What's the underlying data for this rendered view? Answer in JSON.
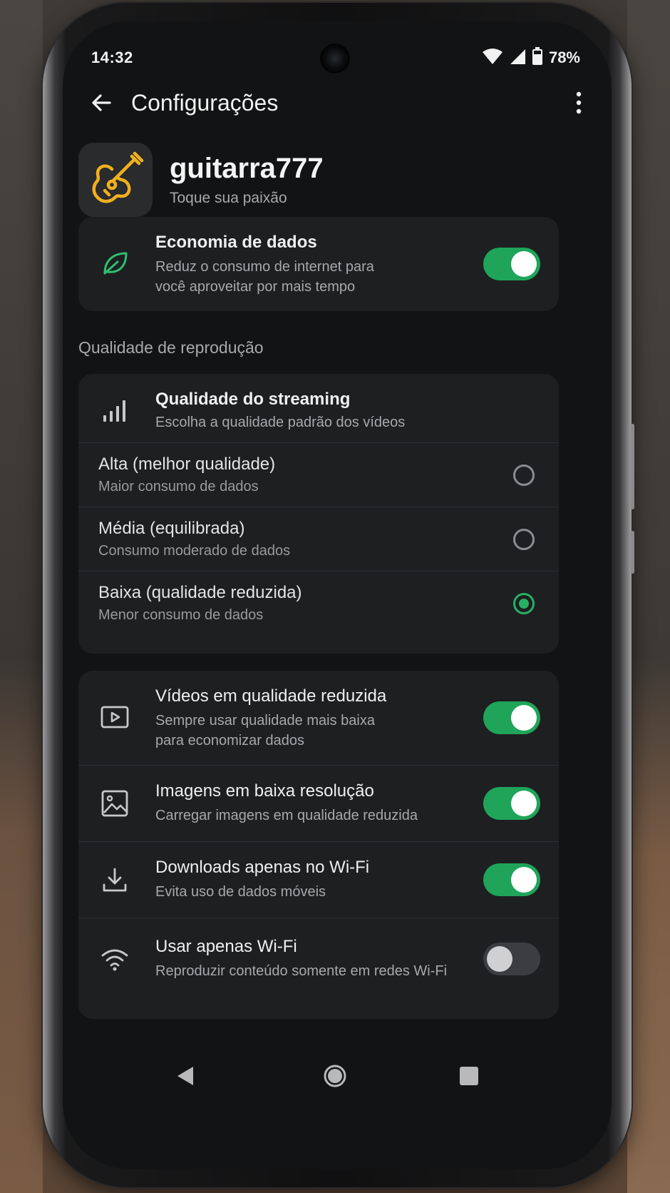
{
  "status_bar": {
    "time": "14:32",
    "battery": "78%",
    "icons": [
      "wifi-icon",
      "signal-icon",
      "battery-icon"
    ]
  },
  "app_bar": {
    "title": "Configurações",
    "icons": [
      "back-arrow-icon",
      "more-vert-icon"
    ]
  },
  "profile": {
    "name": "guitarra777",
    "tagline": "Toque sua paixão",
    "icon": "guitar-icon"
  },
  "data_saver": {
    "title": "Economia de dados",
    "subtitle_line1": "Reduz o consumo de internet para",
    "subtitle_line2": "você aproveitar por mais tempo",
    "icon": "leaf-icon",
    "enabled": true
  },
  "playback_section": {
    "title": "Qualidade de reprodução"
  },
  "streaming": {
    "title": "Qualidade do streaming",
    "subtitle": "Escolha a qualidade padrão dos vídeos",
    "icon": "signal-bars-icon",
    "options": [
      {
        "title": "Alta (melhor qualidade)",
        "subtitle": "Maior consumo de dados",
        "selected": false
      },
      {
        "title": "Média (equilibrada)",
        "subtitle": "Consumo moderado de dados",
        "selected": false
      },
      {
        "title": "Baixa (qualidade reduzida)",
        "subtitle": "Menor consumo de dados",
        "selected": true
      }
    ]
  },
  "settings": [
    {
      "title": "Vídeos em qualidade reduzida",
      "subtitle_line1": "Sempre usar qualidade mais baixa",
      "subtitle_line2": "para economizar dados",
      "icon": "video-icon",
      "enabled": true
    },
    {
      "title": "Imagens em baixa resolução",
      "subtitle_line1": "Carregar imagens em qualidade reduzida",
      "icon": "image-icon",
      "enabled": true
    },
    {
      "title": "Downloads apenas no Wi-Fi",
      "subtitle_line1": "Evita uso de dados móveis",
      "icon": "download-icon",
      "enabled": true
    },
    {
      "title": "Usar apenas Wi-Fi",
      "subtitle_line1": "Reproduzir conteúdo somente em redes Wi-Fi",
      "icon": "wifi-icon",
      "enabled": false
    }
  ],
  "nav_bar": {
    "icons": [
      "nav-back-icon",
      "nav-home-icon",
      "nav-recents-icon"
    ]
  },
  "colors": {
    "accent": "#1fa45a",
    "leaf": "#2fbf70",
    "guitar": "#f2b01e",
    "background": "#121314",
    "card": "#1e1f21"
  }
}
